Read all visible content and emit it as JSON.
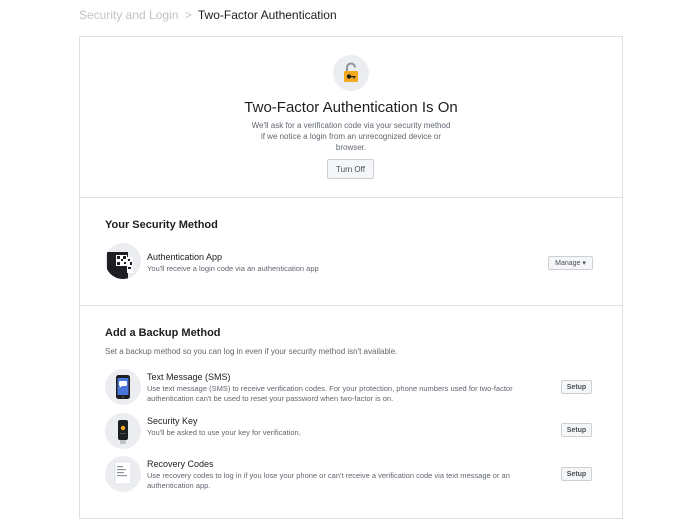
{
  "breadcrumb": {
    "parent": "Security and Login",
    "separator": ">",
    "current": "Two-Factor Authentication"
  },
  "hero": {
    "icon": "padlock-icon",
    "title": "Two-Factor Authentication Is On",
    "description": "We'll ask for a verification code via your security method if we notice a login from an unrecognized device or browser.",
    "button": "Turn Off"
  },
  "security_method": {
    "title": "Your Security Method",
    "method": {
      "icon": "authentication-app-icon",
      "name": "Authentication App",
      "description": "You'll receive a login code via an authentication app",
      "button": "Manage",
      "button_caret": "▾"
    }
  },
  "backup": {
    "title": "Add a Backup Method",
    "subtitle": "Set a backup method so you can log in even if your security method isn't available.",
    "methods": [
      {
        "icon": "text-message-phone-icon",
        "name": "Text Message (SMS)",
        "description": "Use text message (SMS) to receive verification codes. For your protection, phone numbers used for two-factor authentication can't be used to reset your password when two-factor is on.",
        "button": "Setup"
      },
      {
        "icon": "security-key-icon",
        "name": "Security Key",
        "description": "You'll be asked to use your key for verification.",
        "button": "Setup"
      },
      {
        "icon": "recovery-codes-icon",
        "name": "Recovery Codes",
        "description": "Use recovery codes to log in if you lose your phone or can't receive a verification code via text message or an authentication app.",
        "button": "Setup"
      }
    ]
  },
  "colors": {
    "border": "#dddfe2",
    "muted_text": "#606770",
    "breadcrumb_link": "#bec3c9",
    "icon_bg": "#ebedf0",
    "lock_gold": "#f2a91c",
    "phone_blue": "#4a76d9"
  }
}
